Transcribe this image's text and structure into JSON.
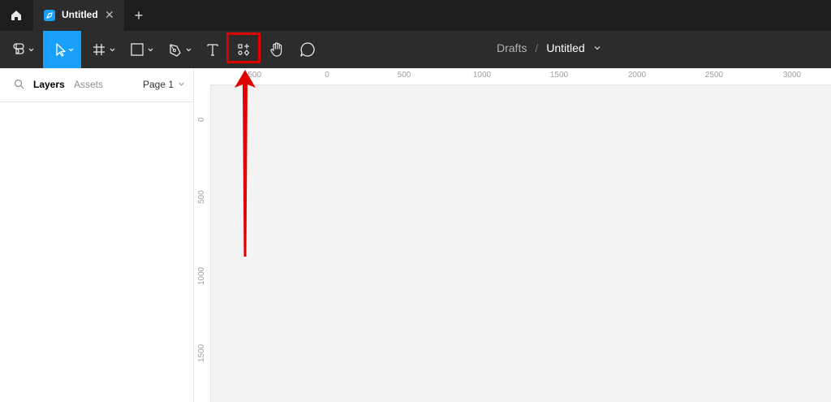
{
  "tabs": [
    {
      "title": "Untitled",
      "close": "✕"
    }
  ],
  "new_tab": "+",
  "toolbar": {
    "tools": [
      "main-menu",
      "move",
      "frame",
      "shape",
      "pen",
      "text",
      "resources",
      "hand",
      "comment"
    ],
    "active_tool": "move",
    "highlighted_tool": "resources",
    "accent": "#18a0fb"
  },
  "breadcrumb": {
    "folder": "Drafts",
    "separator": "/",
    "file": "Untitled"
  },
  "left_panel": {
    "tab_layers": "Layers",
    "tab_assets": "Assets",
    "page": "Page 1"
  },
  "ruler": {
    "top_ticks": [
      "-500",
      "0",
      "500",
      "1000",
      "1500",
      "2000",
      "2500",
      "3000"
    ],
    "left_ticks": [
      "0",
      "500",
      "1000",
      "1500"
    ]
  },
  "annotation": {
    "color": "#e00000"
  }
}
